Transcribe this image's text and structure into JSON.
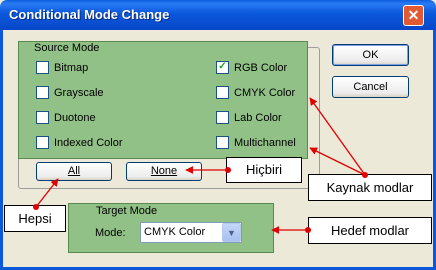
{
  "window": {
    "title": "Conditional Mode Change",
    "close_glyph": "✕"
  },
  "buttons": {
    "ok": "OK",
    "cancel": "Cancel",
    "all": "All",
    "none": "None"
  },
  "source_mode": {
    "label": "Source Mode",
    "left": [
      {
        "label": "Bitmap",
        "checked": false
      },
      {
        "label": "Grayscale",
        "checked": false
      },
      {
        "label": "Duotone",
        "checked": false
      },
      {
        "label": "Indexed Color",
        "checked": false
      }
    ],
    "right": [
      {
        "label": "RGB Color",
        "checked": true
      },
      {
        "label": "CMYK Color",
        "checked": false
      },
      {
        "label": "Lab Color",
        "checked": false
      },
      {
        "label": "Multichannel",
        "checked": false
      }
    ]
  },
  "target_mode": {
    "label": "Target Mode",
    "mode_label": "Mode:",
    "mode_value": "CMYK Color"
  },
  "callouts": {
    "hicbiri": "Hiçbiri",
    "kaynak": "Kaynak modlar",
    "hepsi": "Hepsi",
    "hedef": "Hedef modlar"
  },
  "colors": {
    "titlebar": "#0b58dc",
    "group_highlight": "#92c188",
    "arrow": "#e00000"
  }
}
